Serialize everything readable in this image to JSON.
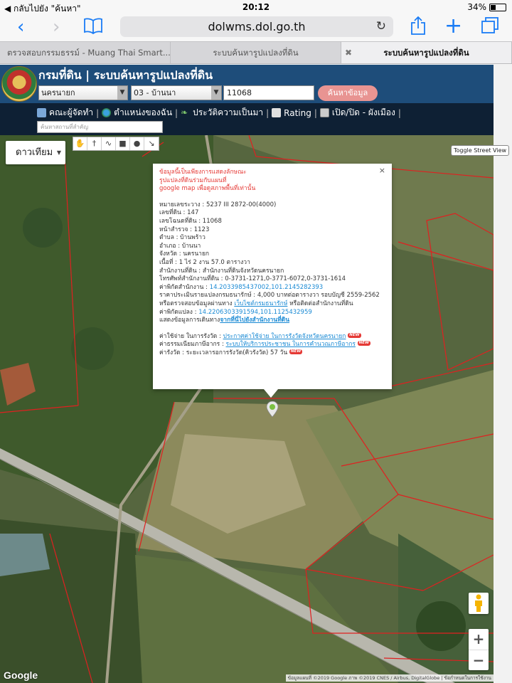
{
  "status_bar": {
    "back_to_app": "◀ กลับไปยัง \"ค้นหา\"",
    "time": "20:12",
    "battery": "34%",
    "battery_level": 0.34
  },
  "browser": {
    "url": "dolwms.dol.go.th",
    "tabs": [
      {
        "label": "ตรวจสอบกรรมธรรม์ - Muang Thai Smart...",
        "active": false
      },
      {
        "label": "ระบบค้นหารูปแปลงที่ดิน",
        "active": false
      },
      {
        "label": "ระบบค้นหารูปแปลงที่ดิน",
        "active": true
      }
    ]
  },
  "site": {
    "title": "กรมที่ดิน | ระบบค้นหารูปแปลงที่ดิน",
    "province_select": "นครนายก",
    "district_select": "03 - บ้านนา",
    "parcel_input": "11068",
    "search_button": "ค้นหาข้อมูล",
    "nav": [
      {
        "label": "คณะผู้จัดทำ",
        "icon": "team-icon"
      },
      {
        "label": "ตำแหน่งของฉัน",
        "icon": "globe-icon"
      },
      {
        "label": "ประวัติความเป็นมา",
        "icon": "history-icon"
      },
      {
        "label": "Rating",
        "icon": "rating-icon"
      },
      {
        "label": "เปิด/ปิด - ผังเมือง",
        "icon": "toggle-icon"
      }
    ],
    "quick_search_placeholder": "ค้นหาสถานที่สำคัญ"
  },
  "map": {
    "map_type": "ดาวเทียม",
    "toggle_street_view": "Toggle Street View",
    "google_label": "Google",
    "attribution": "ข้อมูลแผนที่ ©2019 Google ภาพ ©2019 CNES / Airbus, DigitalGlobe | ข้อกำหนดในการใช้งาน",
    "zoom_in": "+",
    "zoom_out": "−",
    "tools": [
      "hand-icon",
      "pin-icon",
      "polyline-icon",
      "square-icon",
      "circle-icon",
      "measure-icon"
    ]
  },
  "popup": {
    "disclaimer": [
      "ข้อมูลนี้เป็นเพียงการแสดงลักษณะ",
      "รูปแปลงที่ดินร่วมกับแผนที่",
      "google map เพื่อดูสภาพพื้นที่เท่านั้น"
    ],
    "fields": {
      "map_sheet": "หมายเลขระวาง : 5237 III 2872-00(4000)",
      "land_no": "เลขที่ดิน : 147",
      "deed_no": "เลขโฉนดที่ดิน : 11068",
      "survey_page": "หน้าสำรวจ : 1123",
      "subdistrict": "ตำบล : บ้านพร้าว",
      "district": "อำเภอ : บ้านนา",
      "province": "จังหวัด : นครนายก",
      "area": "เนื้อที่ : 1 ไร่ 2 งาน 57.0 ตารางวา",
      "office": "สำนักงานที่ดิน : สำนักงานที่ดินจังหวัดนครนายก",
      "office_phone": "โทรศัพท์สำนักงานที่ดิน : 0-3731-1271,0-3771-6072,0-3731-1614",
      "office_coord_label": "ค่าพิกัดสำนักงาน : ",
      "office_coord_value": "14.2033985437002,101.2145282393",
      "price_text": "ราคาประเมินรายแปลงกรมธนารักษ์ : 4,000 บาทต่อตารางวา รอบบัญชี 2559-2562",
      "check_prefix": "หรือตรวจสอบข้อมูลผ่านทาง ",
      "check_link": "เว็บไซต์กรมธนารักษ์",
      "check_suffix": " หรือติดต่อสำนักงานที่ดิน",
      "parcel_coord_label": "ค่าพิกัดแปลง : ",
      "parcel_coord_value": "14.2206303391594,101.1125432959",
      "route_prefix": "แสดงข้อมูลการเดินทาง",
      "route_link": "จากที่นี่ไปยังสำนักงานที่ดิน",
      "fee_label": "ค่าใช้จ่าย ในการรังวัด : ",
      "fee_link": "ประกาศค่าใช้จ่าย ในการรังวัดจังหวัดนครนายก",
      "tax_label": "ค่าธรรมเนียมภาษีอากร : ",
      "tax_link": "ระบบให้บริการประชาชน ในการคำนวณภาษีอากร",
      "survey_time": "ค่ารังวัด : ระยะเวลารอการรังวัด(คิวรังวัด) 57 วัน",
      "new_badge": "NEW"
    },
    "close": "×"
  }
}
